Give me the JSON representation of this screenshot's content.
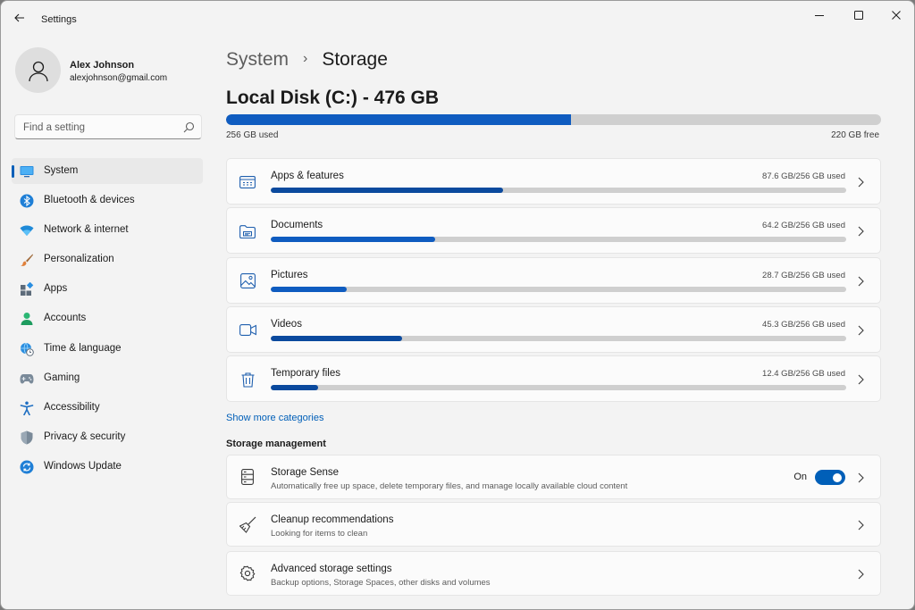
{
  "window": {
    "title": "Settings"
  },
  "user": {
    "name": "Alex Johnson",
    "email": "alexjohnson@gmail.com"
  },
  "search": {
    "placeholder": "Find a setting"
  },
  "nav": {
    "items": [
      {
        "label": "System",
        "icon": "system-monitor-icon",
        "active": true
      },
      {
        "label": "Bluetooth & devices",
        "icon": "bluetooth-icon"
      },
      {
        "label": "Network & internet",
        "icon": "wifi-icon"
      },
      {
        "label": "Personalization",
        "icon": "brush-icon"
      },
      {
        "label": "Apps",
        "icon": "apps-icon"
      },
      {
        "label": "Accounts",
        "icon": "account-icon"
      },
      {
        "label": "Time & language",
        "icon": "globe-clock-icon"
      },
      {
        "label": "Gaming",
        "icon": "gamepad-icon"
      },
      {
        "label": "Accessibility",
        "icon": "accessibility-icon"
      },
      {
        "label": "Privacy & security",
        "icon": "shield-icon"
      },
      {
        "label": "Windows Update",
        "icon": "update-icon"
      }
    ]
  },
  "breadcrumb": {
    "parent": "System",
    "separator": "›",
    "current": "Storage"
  },
  "disk": {
    "title": "Local Disk (C:) - 476 GB",
    "used_label": "256 GB used",
    "free_label": "220 GB free",
    "used_fraction": 0.527
  },
  "categories": [
    {
      "label": "Apps & features",
      "usage": "87.6 GB/256 GB used",
      "fraction": 0.404,
      "icon": "apps-features-icon"
    },
    {
      "label": "Documents",
      "usage": "64.2 GB/256 GB used",
      "fraction": 0.286,
      "icon": "documents-folder-icon"
    },
    {
      "label": "Pictures",
      "usage": "28.7 GB/256 GB used",
      "fraction": 0.132,
      "icon": "pictures-icon"
    },
    {
      "label": "Videos",
      "usage": "45.3 GB/256 GB used",
      "fraction": 0.228,
      "icon": "video-camera-icon"
    },
    {
      "label": "Temporary files",
      "usage": "12.4 GB/256 GB used",
      "fraction": 0.083,
      "icon": "trash-icon"
    }
  ],
  "show_more": "Show more categories",
  "management": {
    "title": "Storage management",
    "items": [
      {
        "label": "Storage Sense",
        "description": "Automatically free up space, delete temporary files, and manage locally available cloud content",
        "toggle": "On",
        "icon": "storage-sense-icon"
      },
      {
        "label": "Cleanup recommendations",
        "description": "Looking for items to clean",
        "icon": "broom-icon"
      },
      {
        "label": "Advanced storage settings",
        "description": "Backup options, Storage Spaces, other disks and volumes",
        "icon": "gear-icon"
      }
    ]
  },
  "colors": {
    "accent": "#005fb8",
    "bar_fill": "#0f5cc0",
    "bar_track": "#cfcfcf",
    "background": "#f3f3f3"
  }
}
